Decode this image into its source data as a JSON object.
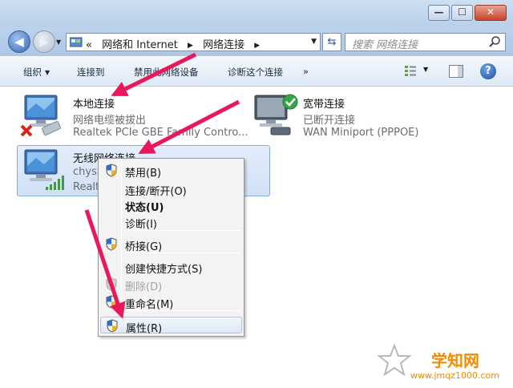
{
  "window": {
    "minimize_glyph": "—",
    "maximize_glyph": "☐",
    "close_glyph": "✕"
  },
  "address": {
    "prefix": "«",
    "crumbs": [
      "网络和 Internet",
      "网络连接"
    ],
    "separator": "▶",
    "search_placeholder": "搜索 网络连接"
  },
  "toolbar": {
    "organize": "组织",
    "connect_to": "连接到",
    "disable_device": "禁用此网络设备",
    "diagnose": "诊断这个连接",
    "more": "»"
  },
  "connections": [
    {
      "name": "本地连接",
      "status": "网络电缆被拔出",
      "device": "Realtek PCIe GBE Family Contro...",
      "icon": "wired-disconnected-icon"
    },
    {
      "name": "宽带连接",
      "status": "已断开连接",
      "device": "WAN Miniport (PPPOE)",
      "icon": "broadband-connected-icon"
    },
    {
      "name": "无线网络连接",
      "status": "chysx",
      "device": "Realte",
      "icon": "wireless-icon"
    }
  ],
  "context_menu": {
    "items": [
      {
        "label": "禁用(B)",
        "shield": true,
        "bold": false,
        "disabled": false
      },
      {
        "label": "连接/断开(O)",
        "shield": false,
        "bold": false,
        "disabled": false
      },
      {
        "label": "状态(U)",
        "shield": false,
        "bold": true,
        "disabled": false
      },
      {
        "label": "诊断(I)",
        "shield": false,
        "bold": false,
        "disabled": false
      },
      {
        "label": "桥接(G)",
        "shield": true,
        "bold": false,
        "disabled": false
      },
      {
        "label": "创建快捷方式(S)",
        "shield": false,
        "bold": false,
        "disabled": false
      },
      {
        "label": "删除(D)",
        "shield": true,
        "bold": false,
        "disabled": true
      },
      {
        "label": "重命名(M)",
        "shield": true,
        "bold": false,
        "disabled": false
      },
      {
        "label": "属性(R)",
        "shield": true,
        "bold": false,
        "disabled": false,
        "highlighted": true
      }
    ]
  },
  "colors": {
    "arrow": "#e8185a",
    "watermark": "#f28b00"
  },
  "watermark": {
    "brand": "学知网",
    "site": "www.jmqz1000.com"
  }
}
